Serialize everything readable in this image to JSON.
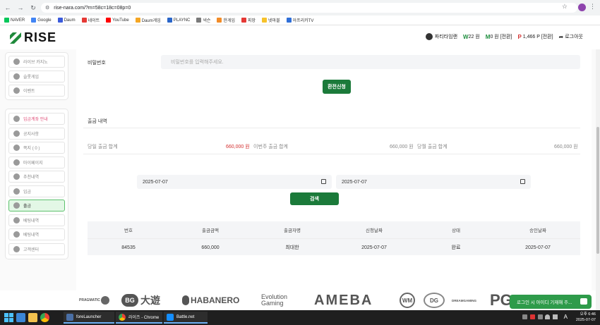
{
  "browser": {
    "url": "rise-nara.com/?m=58c=18c=08p=0",
    "bookmarks": [
      {
        "label": "NAVER",
        "color": "#03c75a"
      },
      {
        "label": "Google",
        "color": "#4285f4"
      },
      {
        "label": "Daum",
        "color": "#3b5bdb"
      },
      {
        "label": "네이트",
        "color": "#e53935"
      },
      {
        "label": "YouTube",
        "color": "#ff0000"
      },
      {
        "label": "Daum게임",
        "color": "#f5a623"
      },
      {
        "label": "PLAYNC",
        "color": "#2a66c9"
      },
      {
        "label": "넥슨",
        "color": "#7a7a7a"
      },
      {
        "label": "한게임",
        "color": "#f28c28"
      },
      {
        "label": "피망",
        "color": "#e53935"
      },
      {
        "label": "넷마블",
        "color": "#f6c22b"
      },
      {
        "label": "아프리카TV",
        "color": "#2f6fd8"
      }
    ]
  },
  "header": {
    "logo": "RISE",
    "rank": "파티타임랜",
    "won_prefix": "W",
    "won_value": "22 원",
    "m_prefix": "M",
    "m_value": "0 원 [전환]",
    "p_prefix": "P",
    "p_value": "1,466 P [전환]",
    "logout": "로그아웃"
  },
  "sidebar": {
    "group1": [
      "라이브 카지노",
      "슬롯게임",
      "이벤트"
    ],
    "group2": [
      {
        "label": "입금계좌 안내",
        "hot": true
      },
      {
        "label": "공지사항"
      },
      {
        "label": "쪽지 ( 0 )"
      },
      {
        "label": "마이페이지"
      },
      {
        "label": "추천내역"
      },
      {
        "label": "입금"
      },
      {
        "label": "출금",
        "active": true
      },
      {
        "label": "베팅내역"
      },
      {
        "label": "베팅내역"
      },
      {
        "label": "고객센터"
      }
    ]
  },
  "form": {
    "password_label": "비밀번호",
    "password_placeholder": "비밀번호를 입력해주세요.",
    "submit": "환전신청"
  },
  "history": {
    "title": "출금 내역",
    "today_label": "당일 출금 합계",
    "today_value": "660,000 원",
    "week_label": "이번주 출금 합계",
    "week_value": "660,000 원",
    "today2_label": "당월 출금 합계",
    "today2_value": "660,000 원",
    "date_from": "2025-07-07",
    "date_to": "2025-07-07",
    "search": "검색",
    "columns": [
      "번호",
      "출금금액",
      "출금자명",
      "신청날짜",
      "상태",
      "승인날짜"
    ],
    "rows": [
      [
        "84535",
        "660,000",
        "최대한",
        "2025-07-07",
        "완료",
        "2025-07-07"
      ]
    ]
  },
  "providers": [
    "PRAGMATIC",
    "BG",
    "大遊",
    "HABANERO",
    "Evolution Gaming",
    "AMEBA",
    "WM",
    "DG",
    "DREAMGAMING",
    "PG"
  ],
  "chat": {
    "label": "로그인 시 아이디 기재해 주..."
  },
  "taskbar": {
    "apps": [
      "foreLauncher",
      "라이즈 - Chrome",
      "Battle.net"
    ],
    "time": "오후 6:46",
    "date": "2025-07-07",
    "lang": "A"
  }
}
